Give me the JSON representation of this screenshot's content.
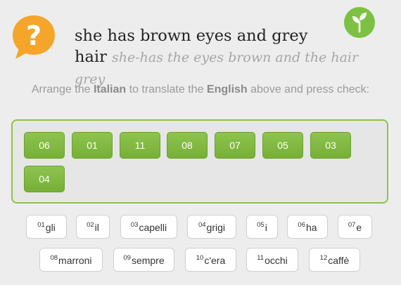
{
  "prompt": {
    "english": "she has brown eyes and grey hair",
    "english_line1": "she has brown eyes and grey",
    "english_line2": "hair",
    "literal": "she-has the eyes brown and the hair grey"
  },
  "instructions": {
    "part1": "Arrange the ",
    "lang_from": "Italian",
    "part2": " to translate the ",
    "lang_to": "English",
    "part3": " above and press check:"
  },
  "answer_tiles": [
    "06",
    "01",
    "11",
    "08",
    "07",
    "05",
    "03",
    "04"
  ],
  "word_bank": [
    {
      "num": "01",
      "word": "gli"
    },
    {
      "num": "02",
      "word": "il"
    },
    {
      "num": "03",
      "word": "capelli"
    },
    {
      "num": "04",
      "word": "grigi"
    },
    {
      "num": "05",
      "word": "i"
    },
    {
      "num": "06",
      "word": "ha"
    },
    {
      "num": "07",
      "word": "e"
    },
    {
      "num": "08",
      "word": "marroni"
    },
    {
      "num": "09",
      "word": "sempre"
    },
    {
      "num": "10",
      "word": "c'era"
    },
    {
      "num": "11",
      "word": "occhi"
    },
    {
      "num": "12",
      "word": "caffè"
    }
  ],
  "icons": {
    "question": "question-bubble-icon",
    "sprout": "sprout-icon"
  },
  "colors": {
    "accent_green": "#8dc34a",
    "question_orange": "#f4a52a"
  }
}
